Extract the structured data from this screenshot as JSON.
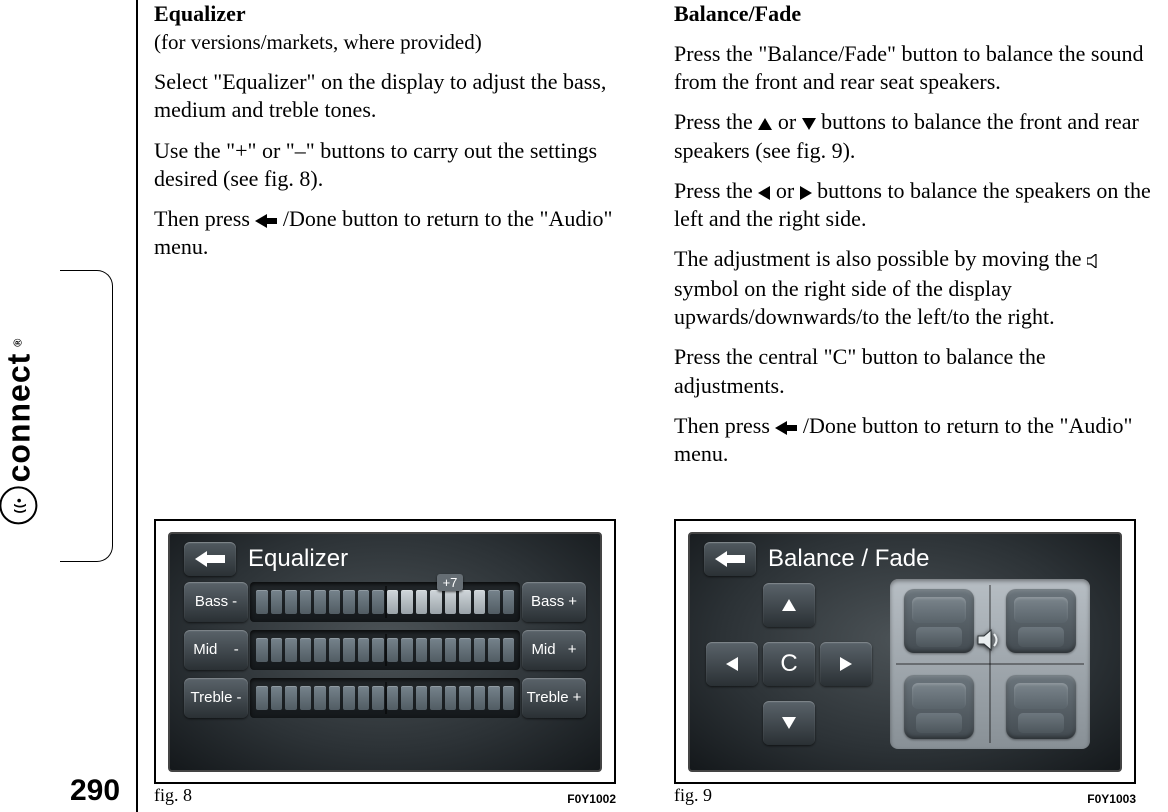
{
  "page_number": "290",
  "brand": {
    "name": "connect",
    "registered": "®"
  },
  "left_column": {
    "heading": "Equalizer",
    "subheading": "(for versions/markets, where provided)",
    "p1": "Select \"Equalizer\" on the display to adjust the bass, medium and treble tones.",
    "p2": "Use the \"+\" or \"–\" buttons to carry out the settings desired (see fig. 8).",
    "p3_a": "Then press ",
    "p3_b": "/Done button to return to the \"Audio\" menu."
  },
  "right_column": {
    "heading": "Balance/Fade",
    "p1": "Press the \"Balance/Fade\" button to balance the sound from the front and rear seat speakers.",
    "p2_a": "Press the ",
    "p2_b": " or ",
    "p2_c": " buttons to balance the front and rear speakers (see fig. 9).",
    "p3_a": "Press the ",
    "p3_b": " or ",
    "p3_c": " buttons to balance the speakers on the left and the right side.",
    "p4_a": "The adjustment is also possible by moving the ",
    "p4_b": " symbol on the right side of the display upwards/downwards/to the left/to the right.",
    "p5": "Press the central \"C\" button to balance the adjustments.",
    "p6_a": "Then press ",
    "p6_b": "/Done button to return to the \"Audio\" menu."
  },
  "fig8": {
    "caption": "fig. 8",
    "code": "F0Y1002",
    "screen_title": "Equalizer",
    "value_indicator": "+7",
    "rows": {
      "bass_minus": "Bass",
      "bass_plus": "Bass",
      "mid_minus": "Mid",
      "mid_plus": "Mid",
      "treble_minus": "Treble",
      "treble_plus": "Treble",
      "sign_minus": "-",
      "sign_plus": "+"
    }
  },
  "fig9": {
    "caption": "fig. 9",
    "code": "F0Y1003",
    "screen_title": "Balance / Fade",
    "center_label": "C"
  }
}
